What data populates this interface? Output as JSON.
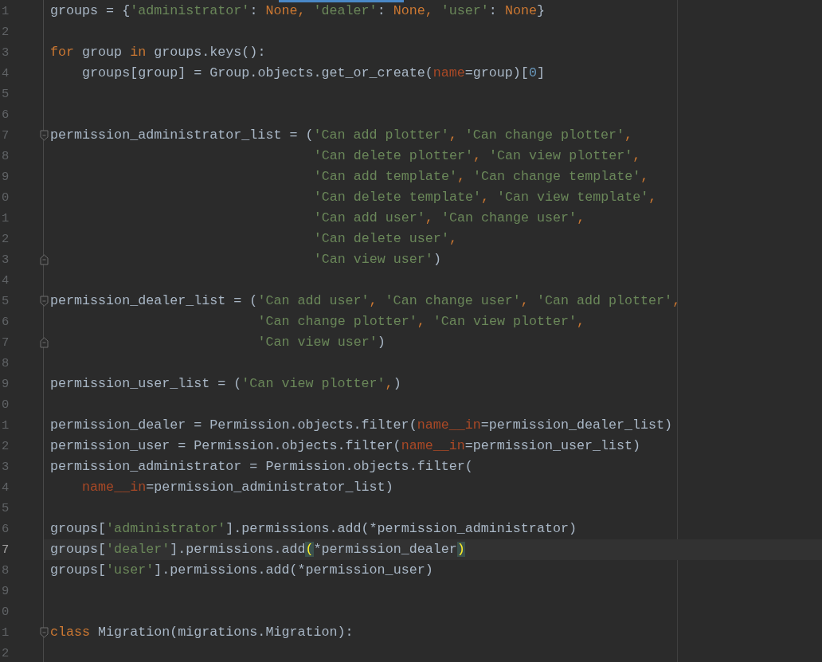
{
  "editor": {
    "lines": [
      {
        "number": "1",
        "kind": "plain",
        "current": false,
        "tokens": [
          {
            "text": "groups = {",
            "kind": "plain"
          },
          {
            "text": "'administrator'",
            "kind": "string"
          },
          {
            "text": ": ",
            "kind": "plain"
          },
          {
            "text": "None, ",
            "kind": "keyword"
          },
          {
            "text": "'dealer'",
            "kind": "string"
          },
          {
            "text": ": ",
            "kind": "plain"
          },
          {
            "text": "None, ",
            "kind": "keyword"
          },
          {
            "text": "'user'",
            "kind": "string"
          },
          {
            "text": ": ",
            "kind": "plain"
          },
          {
            "text": "None",
            "kind": "keyword"
          },
          {
            "text": "}",
            "kind": "plain"
          }
        ]
      },
      {
        "number": "2",
        "kind": "plain",
        "current": false
      },
      {
        "number": "3",
        "kind": "plain",
        "current": false,
        "tokens": [
          {
            "text": "for",
            "kind": "keyword"
          },
          {
            "text": " group ",
            "kind": "plain"
          },
          {
            "text": "in",
            "kind": "keyword"
          },
          {
            "text": " groups.keys():",
            "kind": "plain"
          }
        ],
        "children": [
          {
            "number": "4",
            "kind": "plain",
            "current": false,
            "tokens": [
              {
                "text": "groups[group] = Group.objects.get_or_create(",
                "kind": "plain"
              },
              {
                "text": "name",
                "kind": "param"
              },
              {
                "text": "=group)[",
                "kind": "plain"
              },
              {
                "text": "0",
                "kind": "number"
              },
              {
                "text": "]",
                "kind": "plain"
              }
            ]
          }
        ]
      },
      {
        "number": "5",
        "kind": "plain",
        "current": false
      },
      {
        "number": "6",
        "kind": "plain",
        "current": false
      },
      {
        "number": "7",
        "kind": "fold-start",
        "current": false,
        "tokens": [
          {
            "text": "permission_administrator_list = (",
            "kind": "plain"
          },
          {
            "text": "'Can add plotter'",
            "kind": "string"
          },
          {
            "text": ", ",
            "kind": "keyword"
          },
          {
            "text": "'Can change plotter'",
            "kind": "string"
          },
          {
            "text": ",",
            "kind": "keyword"
          }
        ]
      },
      {
        "number": "8",
        "kind": "continuation",
        "current": false,
        "tokens": [
          {
            "text": "'Can delete plotter'",
            "kind": "string"
          },
          {
            "text": ", ",
            "kind": "keyword"
          },
          {
            "text": "'Can view plotter'",
            "kind": "string"
          },
          {
            "text": ",",
            "kind": "keyword"
          }
        ]
      },
      {
        "number": "9",
        "kind": "continuation",
        "current": false,
        "tokens": [
          {
            "text": "'Can add template'",
            "kind": "string"
          },
          {
            "text": ", ",
            "kind": "keyword"
          },
          {
            "text": "'Can change template'",
            "kind": "string"
          },
          {
            "text": ",",
            "kind": "keyword"
          }
        ]
      },
      {
        "number": "0",
        "kind": "continuation",
        "current": false,
        "tokens": [
          {
            "text": "'Can delete template'",
            "kind": "string"
          },
          {
            "text": ", ",
            "kind": "keyword"
          },
          {
            "text": "'Can view template'",
            "kind": "string"
          },
          {
            "text": ",",
            "kind": "keyword"
          }
        ]
      },
      {
        "number": "1",
        "kind": "continuation",
        "current": false,
        "tokens": [
          {
            "text": "'Can add user'",
            "kind": "string"
          },
          {
            "text": ", ",
            "kind": "keyword"
          },
          {
            "text": "'Can change user'",
            "kind": "string"
          },
          {
            "text": ",",
            "kind": "keyword"
          }
        ]
      },
      {
        "number": "2",
        "kind": "continuation",
        "current": false,
        "tokens": [
          {
            "text": "'Can delete user'",
            "kind": "string"
          },
          {
            "text": ",",
            "kind": "keyword"
          }
        ]
      },
      {
        "number": "3",
        "kind": "fold-end",
        "current": false,
        "tokens": [
          {
            "text": "'Can view user'",
            "kind": "string"
          },
          {
            "text": ")",
            "kind": "plain"
          }
        ]
      },
      {
        "number": "4",
        "kind": "plain",
        "current": false
      },
      {
        "number": "5",
        "kind": "fold-start",
        "current": false,
        "tokens": [
          {
            "text": "permission_dealer_list = (",
            "kind": "plain"
          },
          {
            "text": "'Can add user'",
            "kind": "string"
          },
          {
            "text": ", ",
            "kind": "keyword"
          },
          {
            "text": "'Can change user'",
            "kind": "string"
          },
          {
            "text": ", ",
            "kind": "keyword"
          },
          {
            "text": "'Can add plotter'",
            "kind": "string"
          },
          {
            "text": ",",
            "kind": "keyword"
          }
        ]
      },
      {
        "number": "6",
        "kind": "continuation",
        "current": false,
        "tokens": [
          {
            "text": "'Can change plotter'",
            "kind": "string"
          },
          {
            "text": ", ",
            "kind": "keyword"
          },
          {
            "text": "'Can view plotter'",
            "kind": "string"
          },
          {
            "text": ",",
            "kind": "keyword"
          }
        ]
      },
      {
        "number": "7",
        "kind": "fold-end",
        "current": false,
        "tokens": [
          {
            "text": "'Can view user'",
            "kind": "string"
          },
          {
            "text": ")",
            "kind": "plain"
          }
        ]
      },
      {
        "number": "8",
        "kind": "plain",
        "current": false
      },
      {
        "number": "9",
        "kind": "plain",
        "current": false,
        "tokens": [
          {
            "text": "permission_user_list = (",
            "kind": "plain"
          },
          {
            "text": "'Can view plotter'",
            "kind": "string"
          },
          {
            "text": ",",
            "kind": "keyword"
          },
          {
            "text": ")",
            "kind": "plain"
          }
        ]
      },
      {
        "number": "0",
        "kind": "plain",
        "current": false
      },
      {
        "number": "1",
        "kind": "plain",
        "current": false,
        "tokens": [
          {
            "text": "permission_dealer = Permission.objects.filter(",
            "kind": "plain"
          },
          {
            "text": "name__in",
            "kind": "param"
          },
          {
            "text": "=permission_dealer_list)",
            "kind": "plain"
          }
        ]
      },
      {
        "number": "2",
        "kind": "plain",
        "current": false,
        "tokens": [
          {
            "text": "permission_user = Permission.objects.filter(",
            "kind": "plain"
          },
          {
            "text": "name__in",
            "kind": "param"
          },
          {
            "text": "=permission_user_list)",
            "kind": "plain"
          }
        ]
      },
      {
        "number": "3",
        "kind": "plain",
        "current": false,
        "tokens": [
          {
            "text": "permission_administrator = Permission.objects.filter(",
            "kind": "plain"
          }
        ],
        "children": [
          {
            "number": "4",
            "kind": "plain",
            "current": false,
            "tokens": [
              {
                "text": "name__in",
                "kind": "param"
              },
              {
                "text": "=permission_administrator_list)",
                "kind": "plain"
              }
            ]
          }
        ]
      },
      {
        "number": "5",
        "kind": "plain",
        "current": false
      },
      {
        "number": "6",
        "kind": "plain",
        "current": false,
        "tokens": [
          {
            "text": "groups[",
            "kind": "plain"
          },
          {
            "text": "'administrator'",
            "kind": "string"
          },
          {
            "text": "].permissions.add(*permission_administrator)",
            "kind": "plain"
          }
        ]
      },
      {
        "number": "7",
        "kind": "plain",
        "current": true,
        "tokens": [
          {
            "text": "groups[",
            "kind": "plain"
          },
          {
            "text": "'dealer'",
            "kind": "string"
          },
          {
            "text": "].permissions.add",
            "kind": "plain"
          },
          {
            "text": "(",
            "kind": "matched-bracket"
          },
          {
            "text": "*permission_dealer",
            "kind": "plain"
          },
          {
            "text": ")",
            "kind": "matched-bracket"
          }
        ]
      },
      {
        "number": "8",
        "kind": "plain",
        "current": false,
        "tokens": [
          {
            "text": "groups[",
            "kind": "plain"
          },
          {
            "text": "'user'",
            "kind": "string"
          },
          {
            "text": "].permissions.add(*permission_user)",
            "kind": "plain"
          }
        ]
      },
      {
        "number": "9",
        "kind": "plain",
        "current": false
      },
      {
        "number": "0",
        "kind": "plain",
        "current": false
      },
      {
        "number": "1",
        "kind": "fold-start",
        "current": false,
        "tokens": [
          {
            "text": "class",
            "kind": "keyword"
          },
          {
            "text": " Migration(migrations.Migration):",
            "kind": "plain"
          }
        ]
      },
      {
        "number": "2",
        "kind": "plain",
        "current": false
      }
    ]
  }
}
